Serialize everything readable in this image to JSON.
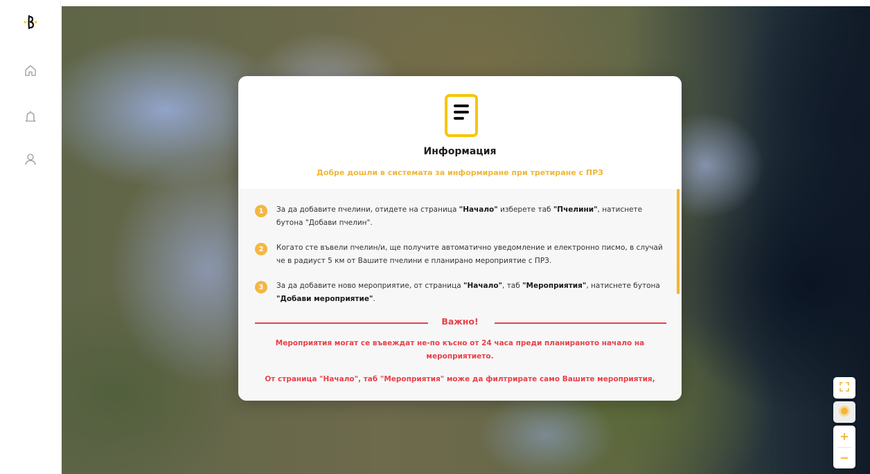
{
  "sidebar": {
    "items": [
      {
        "icon": "bee-logo-icon"
      },
      {
        "icon": "home-icon"
      },
      {
        "icon": "bell-icon"
      },
      {
        "icon": "user-icon"
      }
    ]
  },
  "modal": {
    "icon": "document-icon",
    "title": "Информация",
    "subtitle": "Добре дошли в системата за информиране при третиране с ПРЗ",
    "steps": [
      {
        "number": "1",
        "parts": [
          {
            "text": "За да добавите пчелини, отидете на страница ",
            "bold": false
          },
          {
            "text": "\"Начало\"",
            "bold": true
          },
          {
            "text": " изберете таб ",
            "bold": false
          },
          {
            "text": "\"Пчелини\"",
            "bold": true
          },
          {
            "text": ", натиснете бутона \"Добави пчелин\".",
            "bold": false
          }
        ]
      },
      {
        "number": "2",
        "parts": [
          {
            "text": "Когато сте въвели пчелин/и, ще получите автоматично уведомление и електронно писмо, в случай че в радиуст 5 км от Вашите пчелини е планирано мероприятие с ПРЗ.",
            "bold": false
          }
        ]
      },
      {
        "number": "3",
        "parts": [
          {
            "text": "За да добавите ново мероприятие, от страница ",
            "bold": false
          },
          {
            "text": "\"Начало\"",
            "bold": true
          },
          {
            "text": ", таб ",
            "bold": false
          },
          {
            "text": "\"Мероприятия\"",
            "bold": true
          },
          {
            "text": ", натиснете бутона ",
            "bold": false
          },
          {
            "text": "\"Добави мероприятие\"",
            "bold": true
          },
          {
            "text": ".",
            "bold": false
          }
        ]
      }
    ],
    "important_label": "Важно!",
    "warning_1": "Мероприятия могат се въвеждат не-по късно от 24 часа преди планираното начало на мероприятието.",
    "warning_2": "От страница \"Начало\", таб \"Мероприятия\" може да филтрирате само Вашите мероприятия,"
  },
  "map_controls": {
    "fullscreen_icon": "fullscreen-icon",
    "locate_icon": "sun-icon",
    "zoom_in": "+",
    "zoom_out": "−"
  },
  "colors": {
    "accent": "#f2b535",
    "logo_yellow": "#f7c600",
    "warning_red": "#e8404a"
  }
}
